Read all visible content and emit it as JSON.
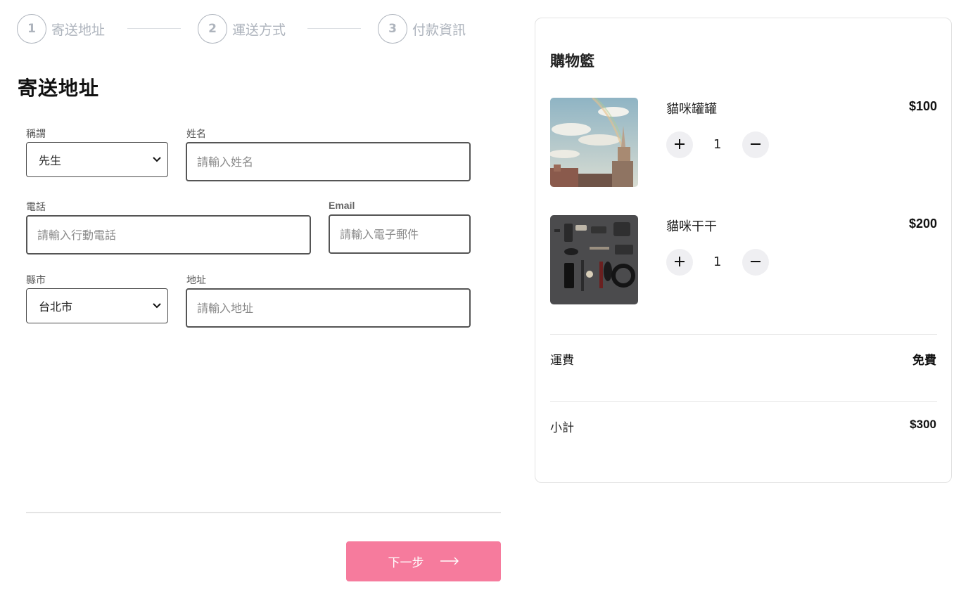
{
  "stepper": {
    "steps": [
      {
        "number": "1",
        "label": "寄送地址"
      },
      {
        "number": "2",
        "label": "運送方式"
      },
      {
        "number": "3",
        "label": "付款資訊"
      }
    ]
  },
  "form": {
    "title": "寄送地址",
    "salutation": {
      "label": "稱謂",
      "value": "先生"
    },
    "name": {
      "label": "姓名",
      "placeholder": "請輸入姓名"
    },
    "phone": {
      "label": "電話",
      "placeholder": "請輸入行動電話"
    },
    "email": {
      "label": "Email",
      "placeholder": "請輸入電子郵件"
    },
    "city": {
      "label": "縣市",
      "value": "台北市"
    },
    "address": {
      "label": "地址",
      "placeholder": "請輸入地址"
    },
    "next_label": "下一步",
    "next_color": "#f67b9d"
  },
  "cart": {
    "title": "購物籃",
    "items": [
      {
        "name": "貓咪罐罐",
        "price": "$100",
        "qty": "1",
        "increase_icon": "plus-icon",
        "decrease_icon": "minus-icon"
      },
      {
        "name": "貓咪干干",
        "price": "$200",
        "qty": "1",
        "increase_icon": "plus-icon",
        "decrease_icon": "minus-icon"
      }
    ],
    "shipping": {
      "label": "運費",
      "value": "免費"
    },
    "subtotal": {
      "label": "小計",
      "value": "$300"
    }
  }
}
